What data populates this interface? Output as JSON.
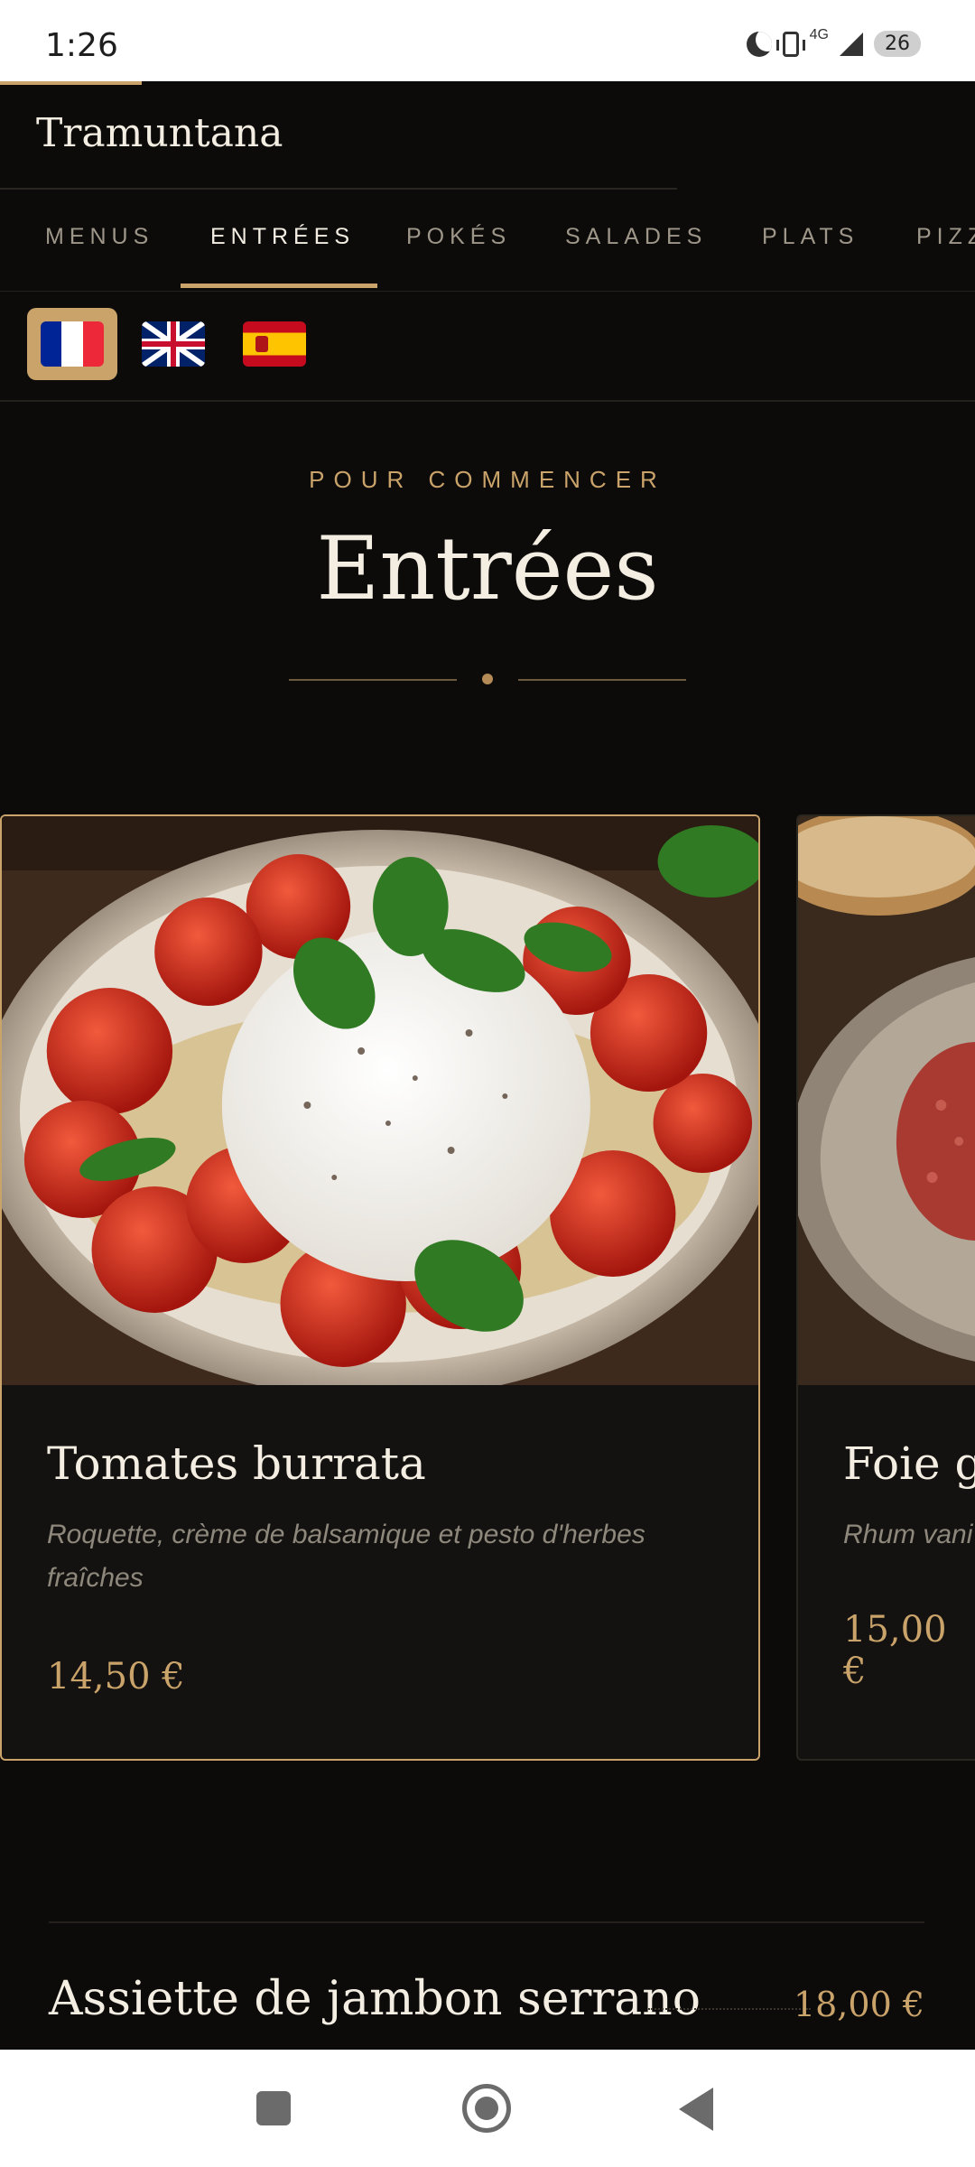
{
  "status_bar": {
    "time": "1:26",
    "network": "4G",
    "battery": "26"
  },
  "header": {
    "brand": "Tramuntana"
  },
  "tabs": [
    {
      "label": "MENUS"
    },
    {
      "label": "ENTRÉES",
      "active": true
    },
    {
      "label": "POKÉS"
    },
    {
      "label": "SALADES"
    },
    {
      "label": "PLATS"
    },
    {
      "label": "PIZZ"
    }
  ],
  "languages": [
    {
      "code": "fr",
      "icon": "flag-france-icon",
      "active": true
    },
    {
      "code": "en",
      "icon": "flag-uk-icon"
    },
    {
      "code": "es",
      "icon": "flag-spain-icon"
    }
  ],
  "section": {
    "eyebrow": "POUR COMMENCER",
    "title": "Entrées"
  },
  "cards": [
    {
      "name": "Tomates burrata",
      "description": "Roquette, crème de balsamique et pesto d'herbes fraîches",
      "price": "14,50 €",
      "image": "burrata-tomatoes-photo"
    },
    {
      "name": "Foie gr",
      "description": "Rhum vani",
      "price": "15,00 €",
      "image": "steak-tartare-photo"
    }
  ],
  "list_items": [
    {
      "name": "Assiette de jambon serrano",
      "price": "18,00 €"
    }
  ],
  "colors": {
    "background": "#0c0b0a",
    "accent": "#c9a36a",
    "text": "#f3ede2",
    "muted": "#9e9789"
  }
}
